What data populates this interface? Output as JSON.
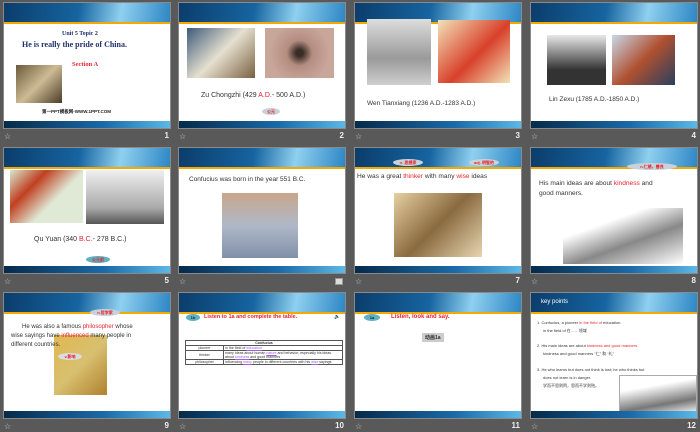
{
  "slides": [
    {
      "number": "1",
      "unit": "Unit 5 Topic 2",
      "title": "He is really the pride  of China.",
      "section": "Section A",
      "footer": "第一PPT模板网-WWW.1PPT.COM"
    },
    {
      "number": "2",
      "name": "Zu Chongzhi",
      "pre": "(429 ",
      "red": "A.D.",
      "post": "- 500 A.D.)",
      "bubble": "公元"
    },
    {
      "number": "3",
      "text": "Wen Tianxiang    (1236 A.D.-1283 A.D.)"
    },
    {
      "number": "4",
      "text": "Lin Zexu    (1785 A.D.-1850 A.D.)"
    },
    {
      "number": "5",
      "pre": "Qu Yuan  (340 ",
      "red": "B.C.",
      "post": "- 278 B.C.)",
      "bubble": "公元前"
    },
    {
      "number": "",
      "text": "Confucius was born in the year 551 B.C.",
      "media_icon": "media-icon"
    },
    {
      "number": "7",
      "t1": "He was a great ",
      "r1": "thinker",
      "t2": " with many ",
      "r2": "wise",
      "t3": " ideas",
      "b1": "n. 思想家",
      "b2": "adj. 明智的"
    },
    {
      "number": "8",
      "t1": "His main ideas are about ",
      "r1": "kindness",
      "t2": " and",
      "t3": "good manners.",
      "bubble": "n.仁慈，善良"
    },
    {
      "number": "9",
      "t1": "He was also a famous ",
      "r1": "philosopher",
      "t2": " whose",
      "t3": "wise sayings have ",
      "r2": "influenced",
      "t4": " many people in",
      "t5": "different  countries.",
      "b1": "n.哲学家",
      "b2": "v.影响"
    },
    {
      "number": "10",
      "badge": "1b",
      "title": "Listen to 1a and complete the table.",
      "table": {
        "header": "Confucius",
        "rows": [
          {
            "k": "pioneer",
            "v": [
              "in the field of ",
              "education",
              ""
            ]
          },
          {
            "k": "thinker",
            "v": [
              "many ideas about human ",
              "nature",
              " and behavior, especially his ideas about ",
              "kindness",
              " and good manners"
            ]
          },
          {
            "k": "philosopher",
            "v": [
              "influencing ",
              "many",
              " people in different countries with his ",
              "wise",
              " sayings"
            ]
          }
        ]
      }
    },
    {
      "number": "11",
      "badge": "1a",
      "title": "Listen,  look and say.",
      "button": "动画1a"
    },
    {
      "number": "12",
      "heading": "key points",
      "p1a": "1. Confucius, a pioneer ",
      "p1r": "in the field of",
      "p1b": " education.",
      "p1c": "in  the field of   在……领域",
      "p2a": "2. His main ideas are about ",
      "p2r": "kindness and good manners.",
      "p2c": "kindness and good manners  “仁”  和  “礼”",
      "p3a": "3. He who learns but does not think is lost; he who thinks but",
      "p3b": "does not learn is in danger.",
      "p3c": "学而不思则罔，思而不学则殆。"
    }
  ]
}
